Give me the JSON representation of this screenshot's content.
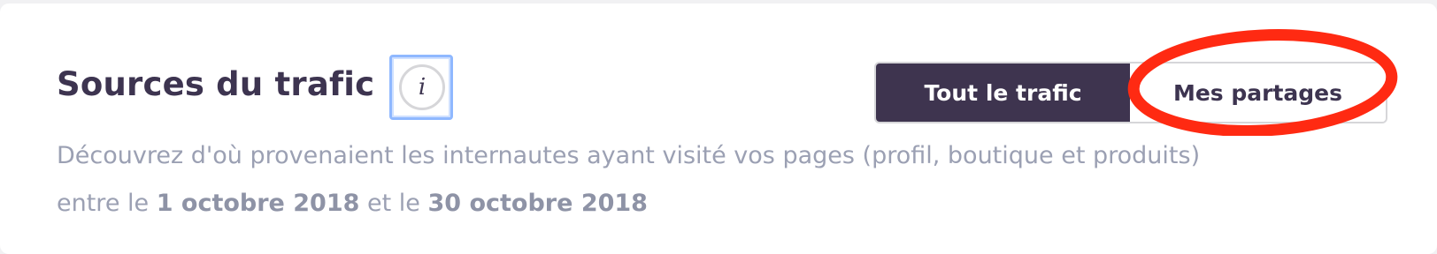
{
  "header": {
    "title": "Sources du trafic",
    "info_glyph": "i"
  },
  "description": {
    "prefix": "Découvrez d'où provenaient les internautes ayant visité vos pages (profil, boutique et produits) entre le ",
    "start_date": "1 octobre 2018",
    "middle": " et le ",
    "end_date": "30 octobre 2018"
  },
  "toggle": {
    "options": [
      {
        "label": "Tout le trafic",
        "selected": true
      },
      {
        "label": "Mes partages",
        "selected": false
      }
    ]
  },
  "colors": {
    "primary_dark": "#3e344f",
    "muted_text": "#9ba0b3",
    "annotation_red": "#ff2a12",
    "focus_blue": "#8fb8ff"
  },
  "icons": {
    "info": "info-icon"
  }
}
